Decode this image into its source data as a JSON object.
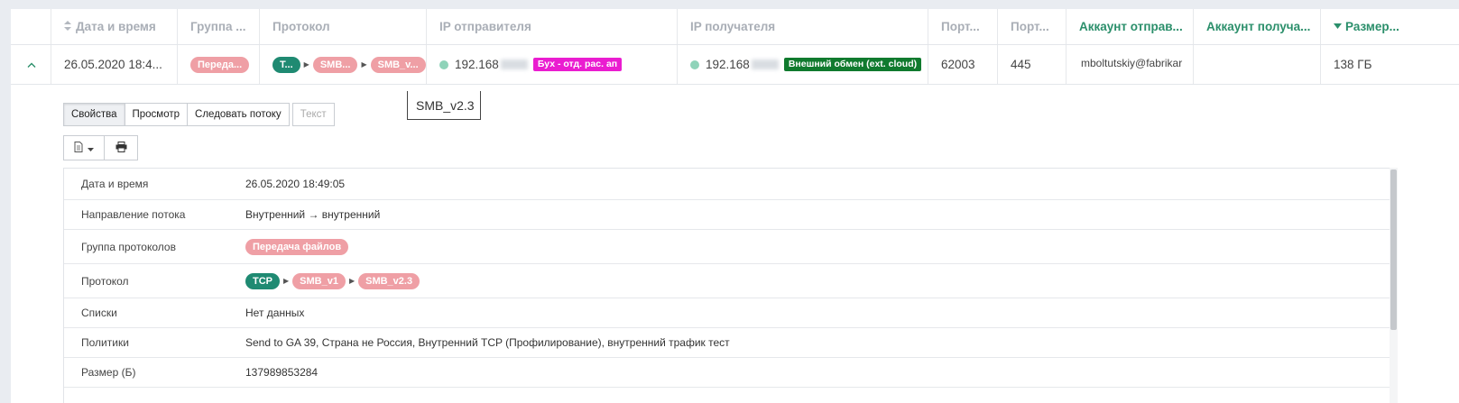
{
  "header": {
    "columns": [
      {
        "label": "Дата и время",
        "sort": "both"
      },
      {
        "label": "Группа ..."
      },
      {
        "label": "Протокол"
      },
      {
        "label": "IP отправителя"
      },
      {
        "label": "IP получателя"
      },
      {
        "label": "Порт..."
      },
      {
        "label": "Порт..."
      },
      {
        "label": "Аккаунт отправ..."
      },
      {
        "label": "Аккаунт получа..."
      },
      {
        "label": "Размер...",
        "sort": "down"
      }
    ]
  },
  "row": {
    "expand_icon": "chevron-up-icon",
    "datetime": "26.05.2020 18:4...",
    "group": "Переда...",
    "protocol": [
      "T...",
      "SMB...",
      "SMB_v..."
    ],
    "sender_ip": "192.168",
    "sender_tag": "Бух - отд. рас. ап",
    "receiver_ip": "192.168",
    "receiver_tag": "Внешний обмен (ext. cloud)",
    "src_port": "62003",
    "dst_port": "445",
    "sender_account": "mboltutskiy@fabrikar",
    "receiver_account": "",
    "size": "138 ГБ"
  },
  "tooltip": "SMB_v2.3",
  "tabs": [
    {
      "label": "Свойства",
      "active": true
    },
    {
      "label": "Просмотр"
    },
    {
      "label": "Следовать потоку"
    },
    {
      "label": "Текст",
      "disabled": true
    }
  ],
  "toolbar": {
    "doc_icon": "document-icon",
    "print_icon": "print-icon"
  },
  "props": {
    "datetime": {
      "key": "Дата и время",
      "value": "26.05.2020 18:49:05"
    },
    "direction": {
      "key": "Направление потока",
      "value": "Внутренний → внутренний"
    },
    "group": {
      "key": "Группа протоколов",
      "value": "Передача файлов"
    },
    "protocol": {
      "key": "Протокол",
      "values": [
        "TCP",
        "SMB_v1",
        "SMB_v2.3"
      ]
    },
    "lists": {
      "key": "Списки",
      "value": "Нет данных"
    },
    "policies": {
      "key": "Политики",
      "value": "Send to GA 39, Страна не Россия, Внутренний TCP (Профилирование), внутренний трафик тест"
    },
    "size": {
      "key": "Размер (Б)",
      "value": "137989853284"
    }
  },
  "colors": {
    "accent": "#2b8f6b",
    "pill_pink": "#ef9fa5",
    "pill_teal": "#1f8a72",
    "tag_magenta": "#ea1dd0",
    "tag_green": "#107a2e"
  }
}
